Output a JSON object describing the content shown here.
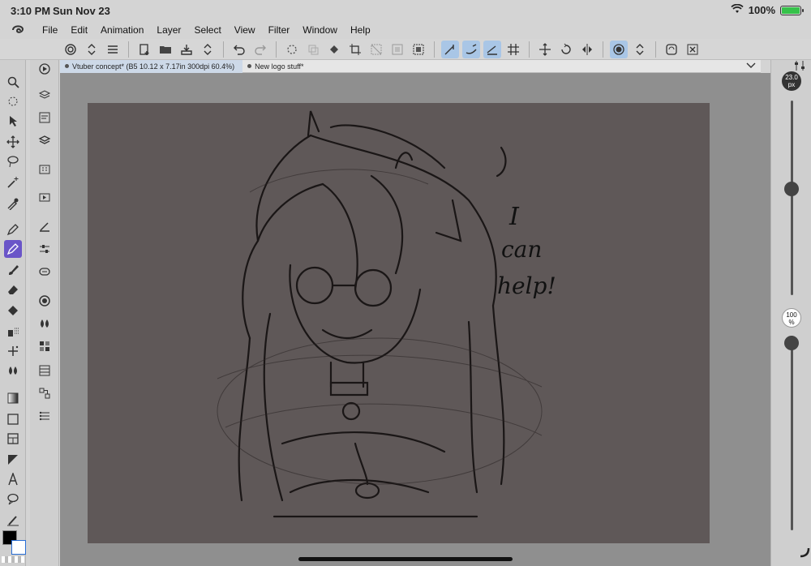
{
  "status_bar": {
    "time": "3:10 PM",
    "date": "Sun Nov 23",
    "battery": "100%"
  },
  "menu": {
    "items": [
      "File",
      "Edit",
      "Animation",
      "Layer",
      "Select",
      "View",
      "Filter",
      "Window",
      "Help"
    ]
  },
  "command_bar": {
    "icons": [
      "spiral-icon",
      "chevron-updown-icon",
      "hamburger-icon",
      "new-file-icon",
      "open-folder-icon",
      "save-icon",
      "chevron-updown-icon",
      "undo-icon",
      "redo-icon",
      "loading-icon",
      "copy-icon",
      "paint-bucket-icon",
      "crop-icon",
      "deselect-icon",
      "select-all-icon",
      "select-border-icon",
      "ruler-snap-icon",
      "brush-snap-icon",
      "ruler-line-icon",
      "grid-icon",
      "transform-icon",
      "rotate-icon",
      "flip-icon",
      "record-icon",
      "chevron-updown-icon",
      "refresh-icon",
      "close-icon"
    ]
  },
  "tabs": [
    {
      "label": "Vtuber concept* (B5 10.12 x 7.17in 300dpi 60.4%)",
      "active": true
    },
    {
      "label": "New logo stuff*",
      "active": false
    }
  ],
  "tools": [
    "zoom-icon",
    "rotate-view-icon",
    "object-icon",
    "move-icon",
    "lasso-icon",
    "magic-wand-icon",
    "eyedropper-icon",
    "pen-icon",
    "pencil-icon",
    "brush-icon",
    "eraser-icon",
    "fill-icon",
    "airbrush-icon",
    "decoration-icon",
    "blend-icon",
    "gradient-icon",
    "figure-icon",
    "frame-icon",
    "ruler-icon",
    "text-icon",
    "balloon-icon",
    "line-correction-icon"
  ],
  "subtools": [
    "navigator-icon",
    "layer-property-icon",
    "layer-search-icon",
    "layers-icon",
    "material-icon",
    "animation-icon",
    "brush-settings-icon",
    "sliders-icon",
    "link-icon",
    "color-wheel-icon",
    "droplets-icon",
    "color-set-icon",
    "timeline-icon",
    "node-icon",
    "history-icon"
  ],
  "colors": {
    "main": "#000000",
    "sub": "#ffffff",
    "canvas": "#5f5858",
    "accent_tool": "#6a55c8"
  },
  "brush": {
    "size_label": "23.0",
    "size_unit": "px",
    "size_fraction": 0.55,
    "opacity_label": "100",
    "opacity_unit": "%",
    "opacity_fraction": 1.0
  },
  "canvas_text": {
    "handwriting": [
      "I",
      "can",
      "help!"
    ]
  }
}
